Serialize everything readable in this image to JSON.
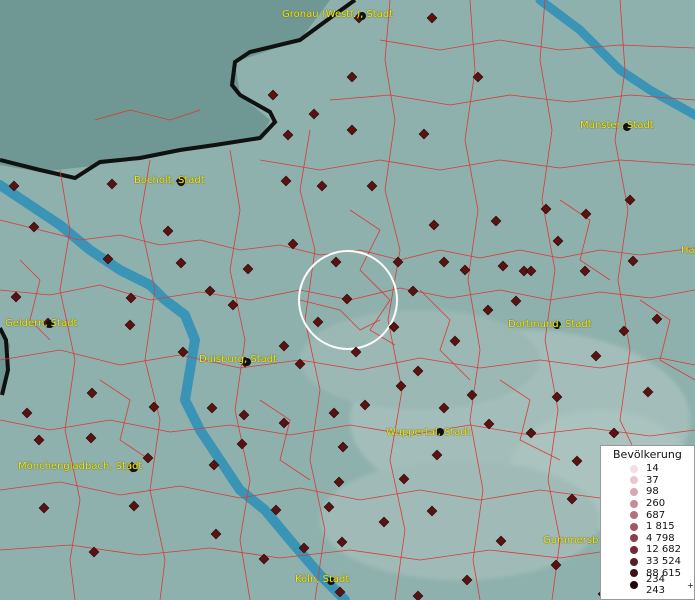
{
  "map": {
    "places": [
      {
        "name": "Gronau (Westf.), Stadt"
      },
      {
        "name": "Münster, Stadt"
      },
      {
        "name": "Bocholt, Stadt"
      },
      {
        "name": "Geldern, Stadt"
      },
      {
        "name": "Duisburg, Stadt"
      },
      {
        "name": "Dortmund, Stadt"
      },
      {
        "name": "Wuppertal, Stadt"
      },
      {
        "name": "Mönchengladbach, Stadt"
      },
      {
        "name": "Gummersb"
      },
      {
        "name": "Köln, Stadt"
      },
      {
        "name": "Ha"
      }
    ],
    "colors": {
      "water": "#3a94b6",
      "land": "#8fb1ad",
      "boundary": "#d83a3a",
      "border": "#111111",
      "label": "#ffe600",
      "marker": "#5a1212"
    }
  },
  "legend": {
    "title": "Bevölkerung",
    "items": [
      {
        "label": "14",
        "color": "#f6dce4"
      },
      {
        "label": "37",
        "color": "#ecc4ce"
      },
      {
        "label": "98",
        "color": "#dba6b2"
      },
      {
        "label": "260",
        "color": "#c98a97"
      },
      {
        "label": "687",
        "color": "#b5707c"
      },
      {
        "label": "1 815",
        "color": "#a05763"
      },
      {
        "label": "4 798",
        "color": "#88404b"
      },
      {
        "label": "12 682",
        "color": "#712d37"
      },
      {
        "label": "33 524",
        "color": "#581e25"
      },
      {
        "label": "88 615",
        "color": "#3e1117"
      },
      {
        "label": "234 243",
        "color": "#22070a",
        "suffix": "+"
      }
    ]
  }
}
